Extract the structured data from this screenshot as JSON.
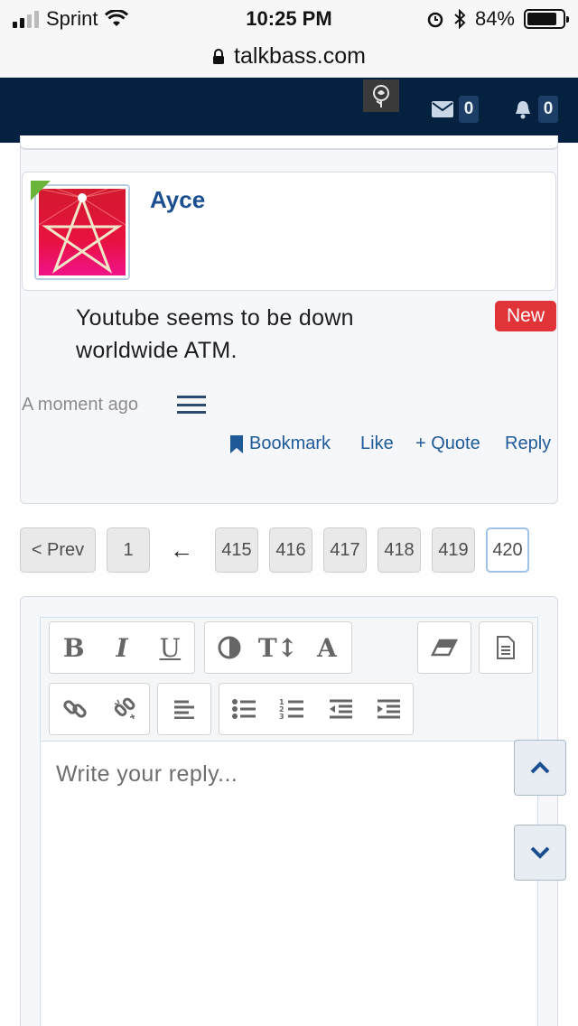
{
  "status_bar": {
    "carrier": "Sprint",
    "time": "10:25 PM",
    "battery": "84%",
    "battery_level": 0.84
  },
  "browser": {
    "url": "talkbass.com"
  },
  "header": {
    "messages_count": "0",
    "alerts_count": "0"
  },
  "post": {
    "username": "Ayce",
    "badge": "New",
    "message": "Youtube seems to be down worldwide ATM.",
    "time": "A moment ago",
    "actions": {
      "bookmark": "Bookmark",
      "like": "Like",
      "quote": "+ Quote",
      "reply": "Reply"
    }
  },
  "pagination": {
    "prev": "< Prev",
    "first": "1",
    "ellipsis": "←",
    "pages": [
      "415",
      "416",
      "417",
      "418",
      "419",
      "420"
    ],
    "current": "420"
  },
  "editor": {
    "bold": "B",
    "italic": "I",
    "underline": "U",
    "font_size": "T↕",
    "font": "A",
    "placeholder": "Write your reply..."
  },
  "colors": {
    "header_bg": "#042140",
    "link": "#1f5a98",
    "badge_new": "#e03438"
  }
}
